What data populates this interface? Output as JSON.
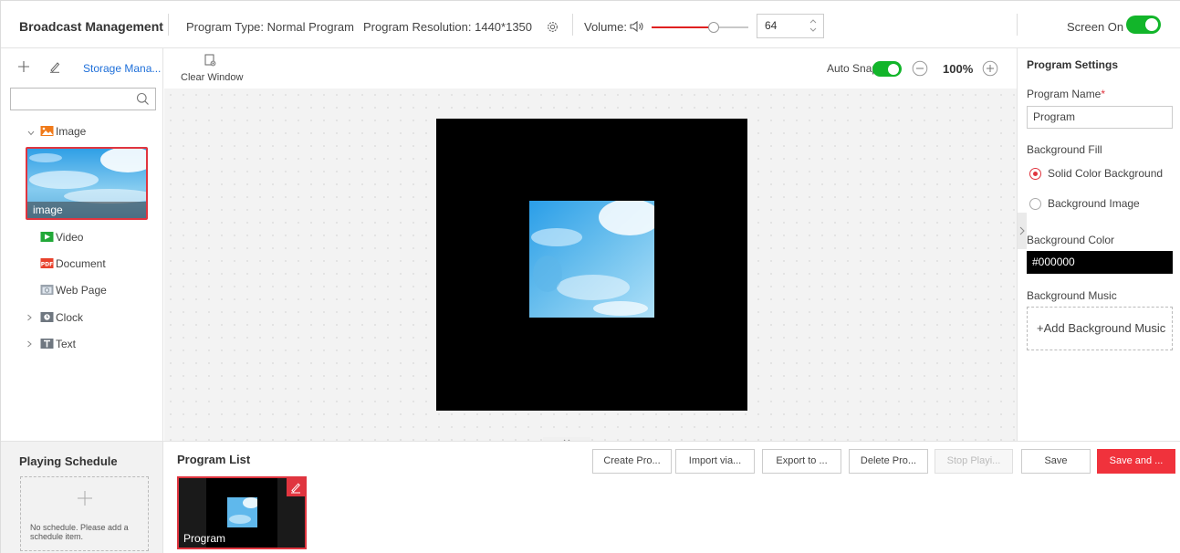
{
  "topbar": {
    "title": "Broadcast Management",
    "program_type": "Program Type: Normal Program",
    "program_resolution": "Program Resolution: 1440*1350",
    "volume_label": "Volume:",
    "volume_value": "64",
    "volume_fraction": 0.64,
    "screen_label": "Screen On",
    "screen_on": true
  },
  "media_panel": {
    "storage_link": "Storage Mana...",
    "search_placeholder": "",
    "tree": {
      "image": "Image",
      "image_thumb_caption": "image",
      "video": "Video",
      "document": "Document",
      "web_page": "Web Page",
      "clock": "Clock",
      "text": "Text"
    }
  },
  "canvas_toolbar": {
    "clear_window": "Clear Window",
    "auto_snap": "Auto Snap",
    "auto_snap_on": true,
    "zoom": "100%"
  },
  "settings": {
    "title": "Program Settings",
    "program_name_label": "Program Name",
    "required_mark": "*",
    "program_name_value": "Program",
    "background_fill_label": "Background Fill",
    "fill_options": [
      "Solid Color Background",
      "Background Image"
    ],
    "fill_selected": "Solid Color Background",
    "background_color_label": "Background Color",
    "background_color_value": "#000000",
    "background_music_label": "Background Music",
    "add_music": "+Add Background Music"
  },
  "schedule": {
    "title": "Playing Schedule",
    "empty_message": "No schedule. Please add a schedule item."
  },
  "program_list": {
    "title": "Program List",
    "buttons": {
      "create": "Create Pro...",
      "import": "Import via...",
      "export": "Export to ...",
      "delete": "Delete Pro...",
      "stop": "Stop Playi...",
      "save": "Save",
      "save_and": "Save and ..."
    },
    "programs": [
      {
        "name": "Program"
      }
    ]
  },
  "colors": {
    "accent_red": "#e0353f",
    "toggle_green": "#12b52a",
    "link_blue": "#1e6fd9"
  },
  "icons": [
    "plus-icon",
    "pencil-icon",
    "search-icon",
    "gear-icon",
    "speaker-icon",
    "spinner-icon",
    "clear-window-icon",
    "zoom-out-icon",
    "zoom-in-icon",
    "chevron-down-icon",
    "chevron-right-icon",
    "image-folder-icon",
    "video-icon",
    "pdf-icon",
    "web-page-icon",
    "clock-icon",
    "text-icon",
    "edit-icon"
  ]
}
